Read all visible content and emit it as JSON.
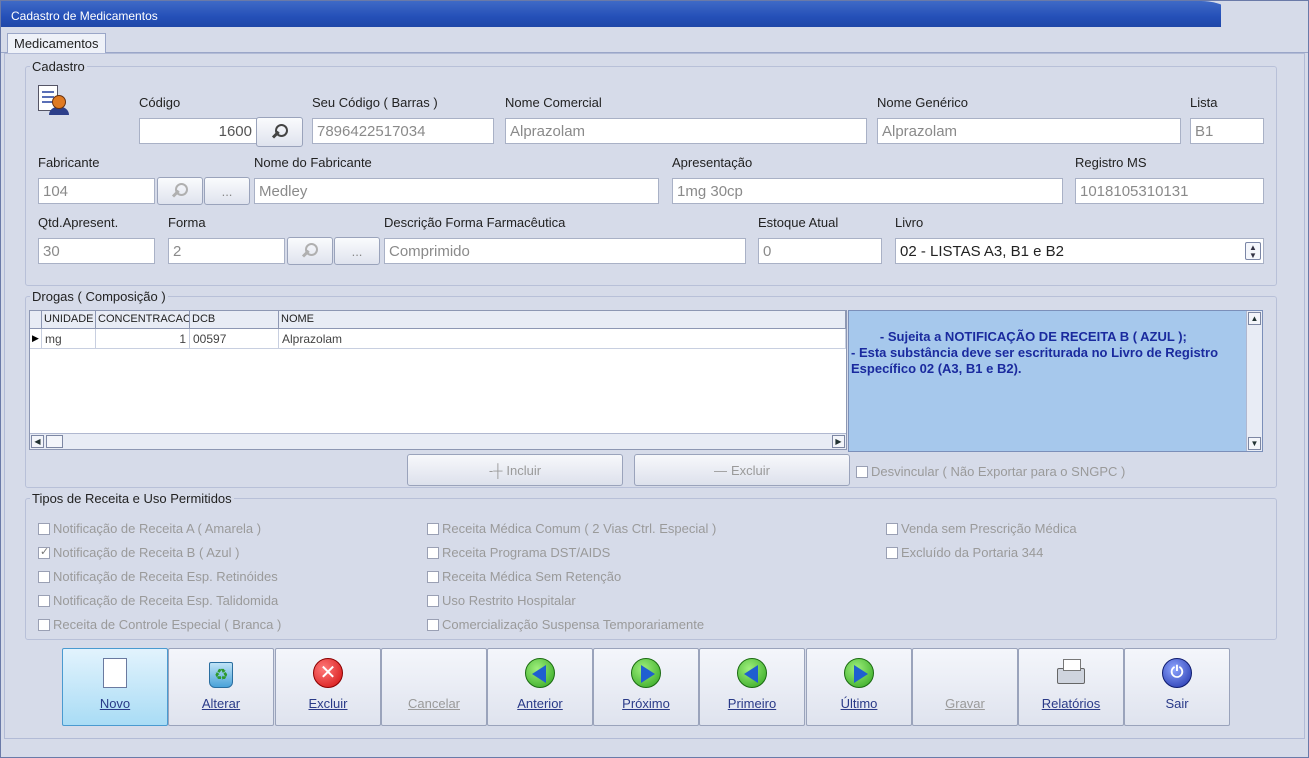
{
  "window": {
    "title": "Cadastro de Medicamentos"
  },
  "tab": {
    "label": "Medicamentos"
  },
  "cadastro": {
    "legend": "Cadastro",
    "codigo": {
      "label": "Código",
      "value": "1600"
    },
    "seu_codigo": {
      "label": "Seu Código ( Barras )",
      "value": "7896422517034"
    },
    "nome_comercial": {
      "label": "Nome Comercial",
      "value": "Alprazolam"
    },
    "nome_generico": {
      "label": "Nome Genérico",
      "value": "Alprazolam"
    },
    "lista": {
      "label": "Lista",
      "value": "B1"
    },
    "fabricante": {
      "label": "Fabricante",
      "value": "104"
    },
    "nome_fabricante": {
      "label": "Nome do Fabricante",
      "value": "Medley"
    },
    "apresentacao": {
      "label": "Apresentação",
      "value": "1mg 30cp"
    },
    "registro_ms": {
      "label": "Registro MS",
      "value": "1018105310131"
    },
    "qtd_apresent": {
      "label": "Qtd.Apresent.",
      "value": "30"
    },
    "forma": {
      "label": "Forma",
      "value": "2"
    },
    "descricao_forma": {
      "label": "Descrição Forma Farmacêutica",
      "value": "Comprimido"
    },
    "estoque_atual": {
      "label": "Estoque Atual",
      "value": "0"
    },
    "livro": {
      "label": "Livro",
      "value": "02 - LISTAS A3, B1 e B2"
    },
    "ellipsis": "..."
  },
  "drogas": {
    "legend": "Drogas ( Composição )",
    "columns": [
      "UNIDADE",
      "CONCENTRACAO",
      "DCB",
      "NOME"
    ],
    "rows": [
      {
        "unidade": "mg",
        "concentracao": "1",
        "dcb": "00597",
        "nome": "Alprazolam"
      }
    ],
    "info_text": "- Sujeita a NOTIFICAÇÃO DE RECEITA B ( AZUL );\n- Esta substância deve ser escriturada no Livro de Registro Específico 02 (A3, B1 e B2).",
    "incluir_label": "Incluir",
    "excluir_label": "Excluir",
    "desvincular_label": "Desvincular ( Não Exportar para o SNGPC )"
  },
  "tipos": {
    "legend": "Tipos de Receita e Uso Permitidos",
    "col1": [
      {
        "label": "Notificação de Receita A ( Amarela )",
        "checked": false
      },
      {
        "label": "Notificação de Receita B ( Azul )",
        "checked": true
      },
      {
        "label": "Notificação de Receita Esp. Retinóides",
        "checked": false
      },
      {
        "label": "Notificação de Receita Esp. Talidomida",
        "checked": false
      },
      {
        "label": "Receita de Controle Especial ( Branca )",
        "checked": false
      }
    ],
    "col2": [
      {
        "label": "Receita Médica Comum ( 2 Vias Ctrl. Especial )",
        "checked": false
      },
      {
        "label": "Receita Programa DST/AIDS",
        "checked": false
      },
      {
        "label": "Receita Médica Sem Retenção",
        "checked": false
      },
      {
        "label": "Uso Restrito Hospitalar",
        "checked": false
      },
      {
        "label": "Comercialização Suspensa Temporariamente",
        "checked": false
      }
    ],
    "col3": [
      {
        "label": "Venda sem Prescrição Médica",
        "checked": false
      },
      {
        "label": "Excluído da Portaria 344",
        "checked": false
      }
    ]
  },
  "toolbar": {
    "novo": "Novo",
    "alterar": "Alterar",
    "excluir": "Excluir",
    "cancelar": "Cancelar",
    "anterior": "Anterior",
    "proximo": "Próximo",
    "primeiro": "Primeiro",
    "ultimo": "Último",
    "gravar": "Gravar",
    "relatorios": "Relatórios",
    "sair": "Sair"
  },
  "colors": {
    "title_bar": "#2550b8",
    "info_box": "#a6c8ec",
    "info_text": "#1a2a9e"
  }
}
